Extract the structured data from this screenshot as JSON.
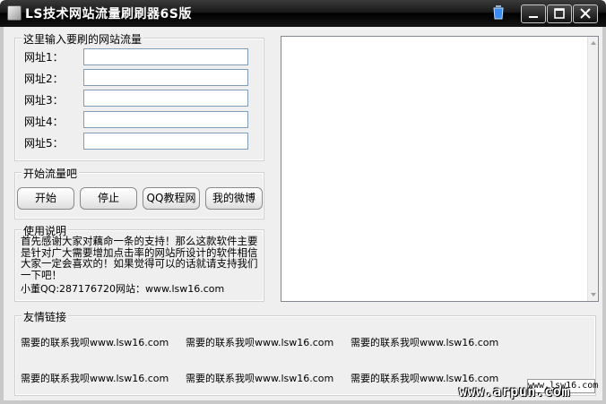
{
  "window": {
    "title": "LS技术网站流量刷刷器6S版",
    "colors": {
      "titlebar": "#000000",
      "body": "#efefef"
    }
  },
  "url_group": {
    "title": "这里输入要刷的网站流量",
    "fields": [
      {
        "label": "网址1：",
        "value": ""
      },
      {
        "label": "网址2：",
        "value": ""
      },
      {
        "label": "网址3：",
        "value": ""
      },
      {
        "label": "网址4：",
        "value": ""
      },
      {
        "label": "网址5：",
        "value": ""
      }
    ]
  },
  "start_group": {
    "title": "开始流量吧",
    "buttons": [
      "开始",
      "停止",
      "QQ教程网",
      "我的微博"
    ]
  },
  "instructions_group": {
    "title": "使用说明",
    "text": "首先感谢大家对藕命一条的支持！那么这款软件主要是针对广大需要增加点击率的网站所设计的软件相信大家一定会喜欢的！如果觉得可以的话就请支持我们一下吧！",
    "contact": "小董QQ:287176720网站：www.lsw16.com"
  },
  "links_group": {
    "title": "友情链接",
    "items": [
      "需要的联系我呗www.lsw16.com",
      "需要的联系我呗www.lsw16.com",
      "需要的联系我呗www.lsw16.com",
      "需要的联系我呗www.lsw16.com",
      "需要的联系我呗www.lsw16.com",
      "需要的联系我呗www.lsw16.com"
    ]
  },
  "watermark": {
    "box_text": "www.lsw16.com",
    "site": "www.arpun.com"
  }
}
